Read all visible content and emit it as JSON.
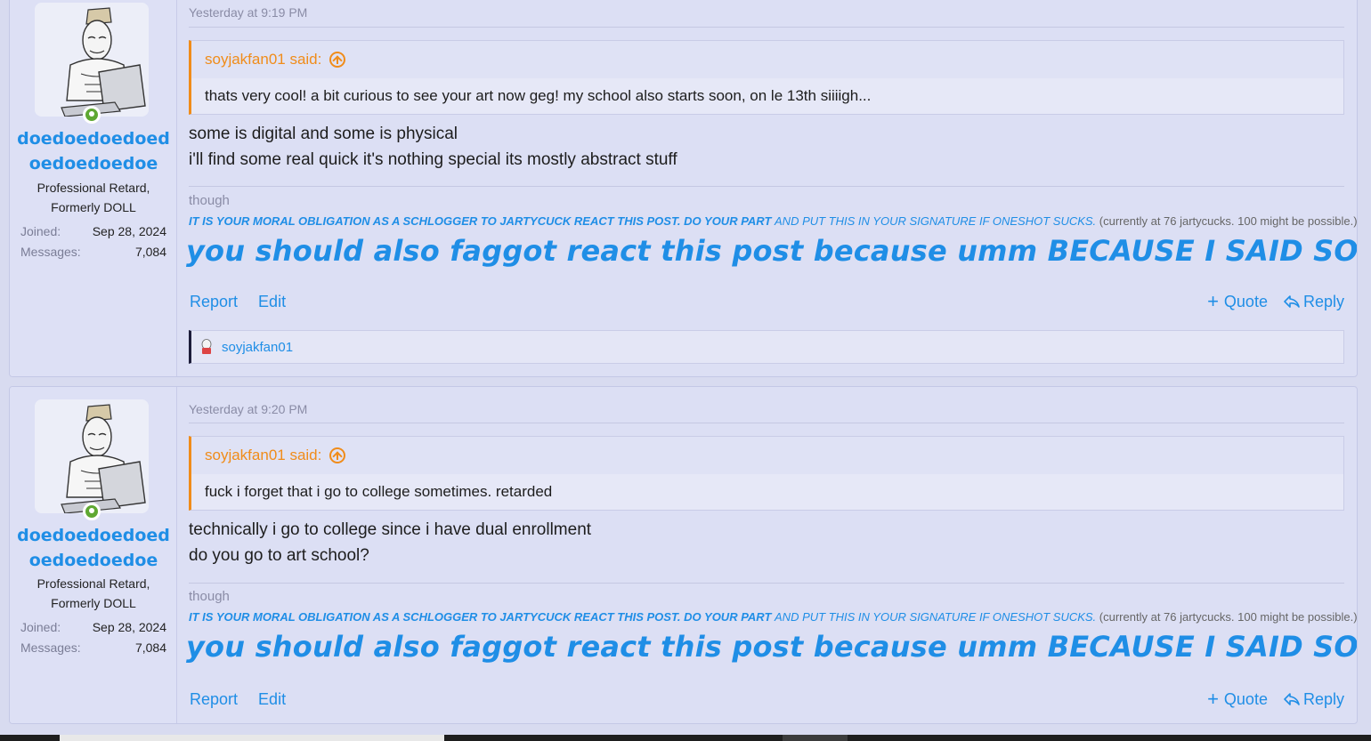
{
  "posts": [
    {
      "user": {
        "name_line1": "doedoedoedoed",
        "name_line2": "oedoedoedoe",
        "title_line1": "Professional Retard,",
        "title_line2": "Formerly DOLL",
        "joined_label": "Joined:",
        "joined_value": "Sep 28, 2024",
        "messages_label": "Messages:",
        "messages_value": "7,084"
      },
      "timestamp": "Yesterday at 9:19 PM",
      "quote": {
        "author": "soyjakfan01 said:",
        "text": "thats very cool! a bit curious to see your art now geg! my school also starts soon, on le 13th siiiigh..."
      },
      "message": {
        "line1": "some is digital and some is physical",
        "line2": "i'll find some real quick it's nothing special its mostly abstract stuff"
      },
      "reactions": {
        "user": "soyjakfan01"
      }
    },
    {
      "user": {
        "name_line1": "doedoedoedoed",
        "name_line2": "oedoedoedoe",
        "title_line1": "Professional Retard,",
        "title_line2": "Formerly DOLL",
        "joined_label": "Joined:",
        "joined_value": "Sep 28, 2024",
        "messages_label": "Messages:",
        "messages_value": "7,084"
      },
      "timestamp": "Yesterday at 9:20 PM",
      "quote": {
        "author": "soyjakfan01 said:",
        "text": "fuck i forget that i go to college sometimes. retarded"
      },
      "message": {
        "line1": "technically i go to college since i have dual enrollment",
        "line2": "do you go to art school?"
      }
    }
  ],
  "signature": {
    "though": "though",
    "bold_part": "IT IS YOUR MORAL OBLIGATION AS A SCHLOGGER TO JARTYCUCK REACT THIS POST. DO YOUR PART",
    "italic_part": "AND PUT THIS IN YOUR SIGNATURE IF ONESHOT SUCKS.",
    "grey_part": "(currently at 76 jartycucks. 100 might be possible.)",
    "big_line": "you should also faggot react this post because umm BECAUSE I SAID SO OKAY"
  },
  "actions": {
    "report": "Report",
    "edit": "Edit",
    "quote": "Quote",
    "reply": "Reply"
  },
  "colors": {
    "accent": "#1f8ee6",
    "quote_accent": "#f08c1a",
    "online": "#5fa832"
  },
  "icons": [
    "avatar",
    "online-indicator-icon",
    "quote-jump-up-icon",
    "plus-icon",
    "reply-icon",
    "reaction-icon"
  ]
}
